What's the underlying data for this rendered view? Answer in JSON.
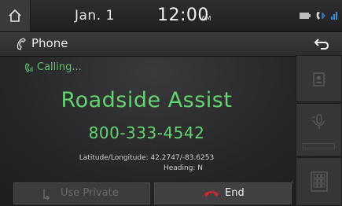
{
  "status": {
    "date": "Jan.  1",
    "time": "12:00",
    "ampm": "AM",
    "icons": [
      "battery-icon",
      "bluetooth-phone-icon",
      "signal-icon"
    ]
  },
  "titlebar": {
    "title": "Phone",
    "icons": [
      "phone-handset-icon",
      "back-arrow-icon"
    ]
  },
  "call": {
    "status": "Calling...",
    "name": "Roadside Assist",
    "number": "800-333-4542",
    "latlon": "Latitude/Longitude: 42.2747/-83.6253",
    "heading": "Heading: N"
  },
  "buttons": {
    "use_private": "Use Private",
    "end": "End"
  },
  "side_buttons": [
    "contacts-icon",
    "mute-mic-icon",
    "keypad-icon"
  ],
  "colors": {
    "accent_green": "#63d46f",
    "end_red": "#e0242c",
    "background": "#262628"
  }
}
